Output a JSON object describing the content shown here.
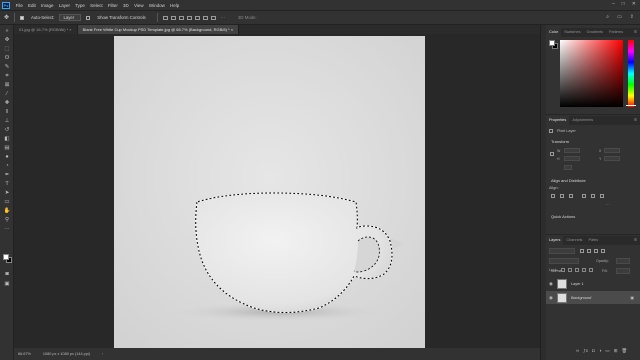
{
  "app": {
    "logo": "Ps",
    "menu": [
      "File",
      "Edit",
      "Image",
      "Layer",
      "Type",
      "Select",
      "Filter",
      "3D",
      "View",
      "Window",
      "Help"
    ],
    "window_controls": [
      "–",
      "□",
      "✕"
    ]
  },
  "options_bar": {
    "move_icon": "move-tool-icon",
    "auto_select_label": "Auto-Select:",
    "auto_select_value": "Layer",
    "transform_label": "Show Transform Controls",
    "mode_3d_label": "3D Mode:"
  },
  "tabs": [
    {
      "label": "01.jpg @ 16.7% (RGB/8#) *  ×",
      "active": false
    },
    {
      "label": "Blank Free White Cup Mockup PSD Template.jpg @ 66.7% (Background, RGB/8) *  ×",
      "active": true
    }
  ],
  "status": {
    "zoom": "66.67%",
    "doc_size": "1080 px x 1080 px (144 ppi)"
  },
  "color_panel": {
    "tabs": [
      "Color",
      "Swatches",
      "Gradients",
      "Patterns"
    ],
    "colors": {
      "fg": "#ffffff",
      "bg": "#000000",
      "field_hue": "#ff0000"
    }
  },
  "properties_panel": {
    "tabs": [
      "Properties",
      "Adjustments"
    ],
    "pixel_layer_label": "Pixel Layer",
    "transform_header": "Transform",
    "w_label": "W",
    "h_label": "H",
    "x_label": "X",
    "y_label": "Y",
    "align_header": "Align and Distribute",
    "align_sub": "Align:",
    "quick_header": "Quick Actions"
  },
  "layers_panel": {
    "tabs": [
      "Layers",
      "Channels",
      "Paths"
    ],
    "kind_label": "Kind",
    "blend_mode": "Normal",
    "opacity_label": "Opacity:",
    "lock_label": "Lock:",
    "fill_label": "Fill:",
    "layers": [
      {
        "name": "Layer 1",
        "selected": false
      },
      {
        "name": "Background",
        "selected": true
      }
    ]
  }
}
